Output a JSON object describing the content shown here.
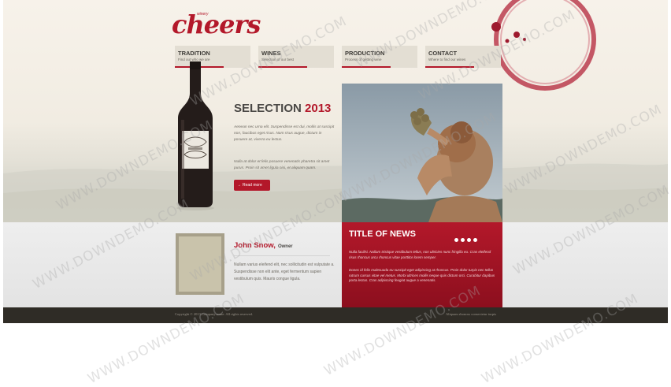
{
  "logo": {
    "brand": "cheers",
    "tagline": "winery"
  },
  "nav": [
    {
      "label": "TRADITION",
      "sub": "Find out who we are"
    },
    {
      "label": "WINES",
      "sub": "Selection of our best"
    },
    {
      "label": "PRODUCTION",
      "sub": "Process of getting wine"
    },
    {
      "label": "CONTACT",
      "sub": "Where to find our wines"
    }
  ],
  "selection": {
    "title": "SELECTION",
    "year": "2013",
    "p1": "Aenean nec urna elit. Suspendisse est dui, mollis at suscipit non, faucibus eget risus. Nam risus augue, dictum in posuere at, viverra eu lectus.",
    "p2": "Nulla at dolor et felis posuere venenatis pharetra sit amet purus. Proin sit amet ligula nisi, et aliquam quam.",
    "button": "Read more",
    "button_icon": "arrow-right-icon"
  },
  "news": {
    "title": "TITLE OF NEWS",
    "p1": "Nulla facilisi. Nullam tristique vestibulum tellus, non ultricies nunc fringilla eu. Cras eleifend risus rhoncus arcu rhoncus vitae porttitor lorem semper.",
    "p2": "Donec id felis malesuada eu suscipit eget adipiscing at rhoncus. Proin dolor turpis nec tellus rutrum cursus vitae vel metus. Morbi ultrices mollis neque quis dictum orci. Curabitur dapibus porta lectus. Cras adipiscing feugiat augue a venenatis."
  },
  "owner": {
    "name": "John Snow,",
    "role": "Owner",
    "text": "Nullam varius eleifend elit, nec sollicitudin est vulputate a. Suspendisse non elit ante, eget fermentum sapien vestibulum quis. Mauris congue ligula."
  },
  "footer": {
    "copyright": "Copyright © 2013 Company name. All rights reserved.",
    "privacy": "Aliquam rhoncus consectetur turpis"
  },
  "watermark": "WWW.DOWNDEMO.COM",
  "colors": {
    "accent": "#b3182a",
    "footer": "#2f2c26",
    "nav_bg": "#e3ded3"
  }
}
